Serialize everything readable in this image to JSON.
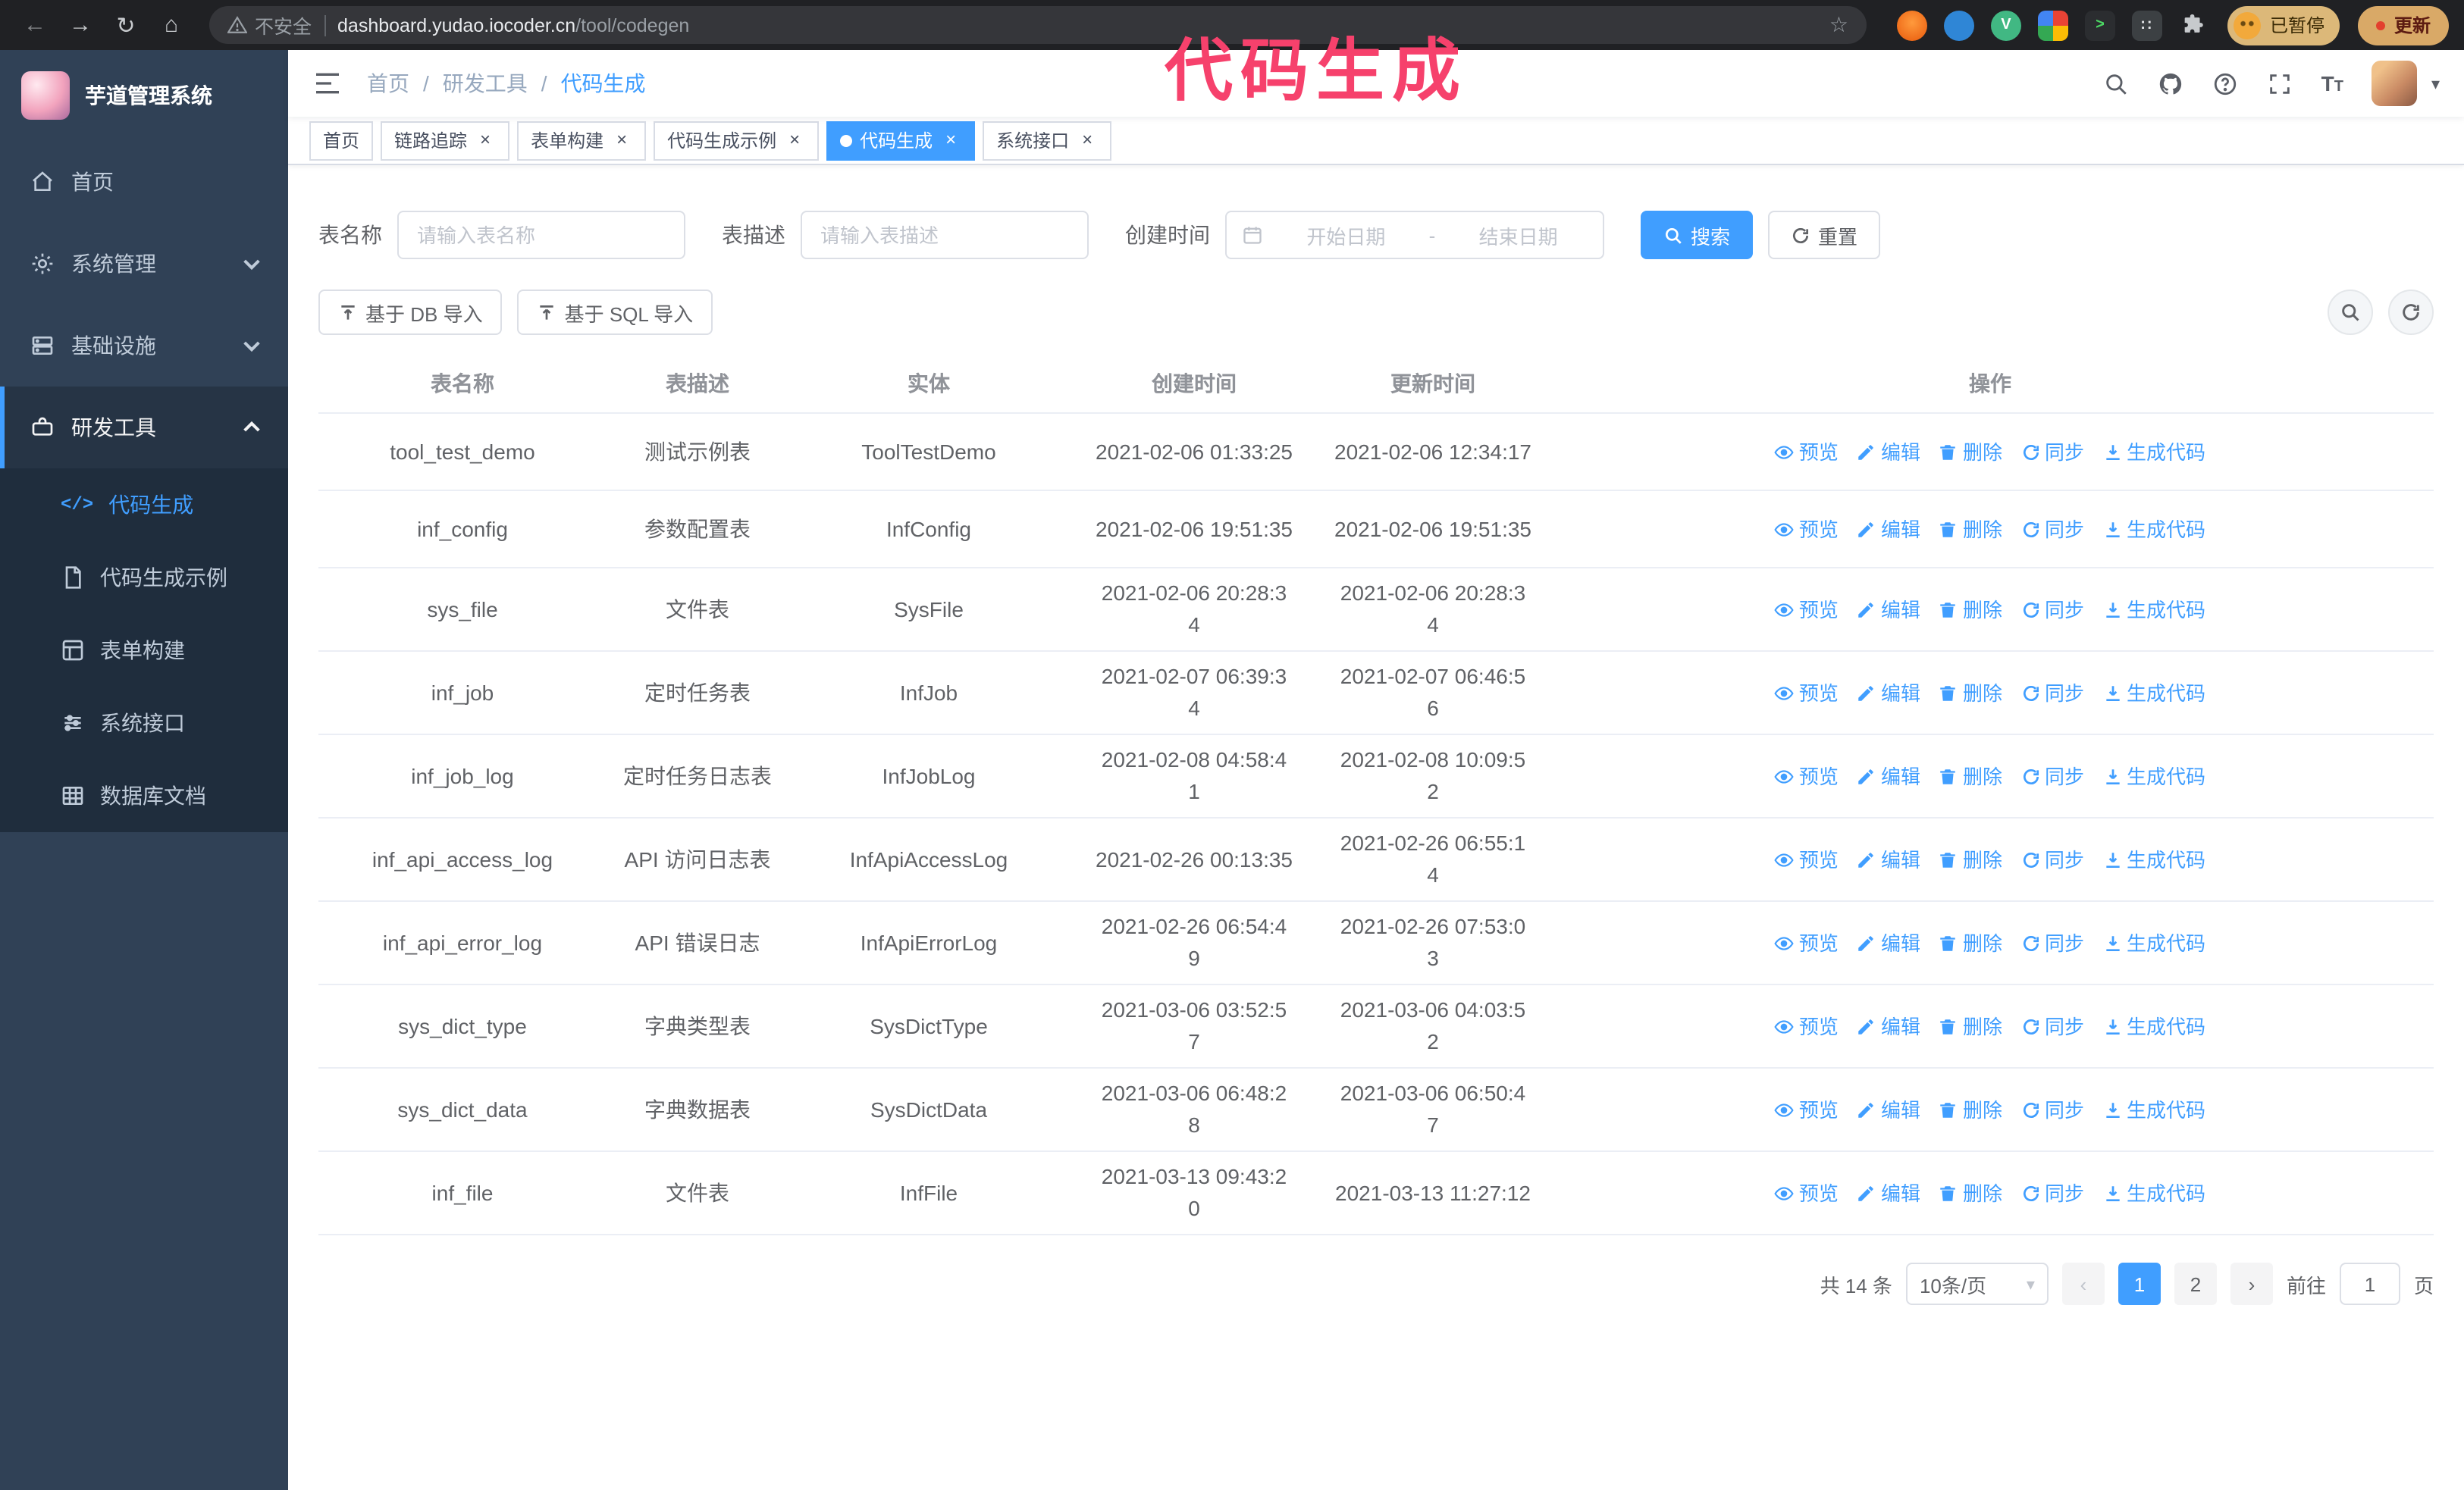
{
  "colors": {
    "primary": "#409eff",
    "annotation": "#f6416c",
    "sidebar_bg": "#304156",
    "submenu_bg": "#1f2d3d"
  },
  "icons": {
    "back": "←",
    "forward": "→",
    "reload": "↻",
    "home": "⌂",
    "star": "☆",
    "close": "×",
    "caret": "▾",
    "dot": "•",
    "separator": "/",
    "prev": "‹",
    "next": "›",
    "code": "</>",
    "terminal": ">",
    "vue": "V",
    "dark_ext": "::"
  },
  "browser": {
    "security_label": "不安全",
    "url_host": "dashboard.yudao.iocoder.cn",
    "url_path": "/tool/codegen",
    "paused_badge": "已暂停",
    "update_button": "更新"
  },
  "overlay": {
    "annotation": "代码生成"
  },
  "sidebar": {
    "app_title": "芋道管理系统",
    "items": [
      {
        "label": "首页"
      },
      {
        "label": "系统管理"
      },
      {
        "label": "基础设施"
      },
      {
        "label": "研发工具"
      }
    ],
    "submenu": [
      {
        "label": "代码生成",
        "active": true
      },
      {
        "label": "代码生成示例"
      },
      {
        "label": "表单构建"
      },
      {
        "label": "系统接口"
      },
      {
        "label": "数据库文档"
      }
    ]
  },
  "header": {
    "breadcrumb": [
      "首页",
      "研发工具",
      "代码生成"
    ]
  },
  "tabs": [
    {
      "label": "首页",
      "closable": false,
      "active": false
    },
    {
      "label": "链路追踪",
      "closable": true,
      "active": false
    },
    {
      "label": "表单构建",
      "closable": true,
      "active": false
    },
    {
      "label": "代码生成示例",
      "closable": true,
      "active": false
    },
    {
      "label": "代码生成",
      "closable": true,
      "active": true
    },
    {
      "label": "系统接口",
      "closable": true,
      "active": false
    }
  ],
  "filters": {
    "table_name_label": "表名称",
    "table_name_placeholder": "请输入表名称",
    "table_desc_label": "表描述",
    "table_desc_placeholder": "请输入表描述",
    "create_time_label": "创建时间",
    "date_start_placeholder": "开始日期",
    "date_separator": "-",
    "date_end_placeholder": "结束日期",
    "search_button": "搜索",
    "reset_button": "重置"
  },
  "toolbar": {
    "import_db": "基于 DB 导入",
    "import_sql": "基于 SQL 导入"
  },
  "table": {
    "columns": [
      "表名称",
      "表描述",
      "实体",
      "创建时间",
      "更新时间",
      "操作"
    ],
    "actions": [
      "预览",
      "编辑",
      "删除",
      "同步",
      "生成代码"
    ],
    "rows": [
      {
        "name": "tool_test_demo",
        "desc": "测试示例表",
        "entity": "ToolTestDemo",
        "created": "2021-02-06 01:33:25",
        "updated": "2021-02-06 12:34:17"
      },
      {
        "name": "inf_config",
        "desc": "参数配置表",
        "entity": "InfConfig",
        "created": "2021-02-06 19:51:35",
        "updated": "2021-02-06 19:51:35"
      },
      {
        "name": "sys_file",
        "desc": "文件表",
        "entity": "SysFile",
        "created": "2021-02-06 20:28:3\n4",
        "updated": "2021-02-06 20:28:3\n4"
      },
      {
        "name": "inf_job",
        "desc": "定时任务表",
        "entity": "InfJob",
        "created": "2021-02-07 06:39:3\n4",
        "updated": "2021-02-07 06:46:5\n6"
      },
      {
        "name": "inf_job_log",
        "desc": "定时任务日志表",
        "entity": "InfJobLog",
        "created": "2021-02-08 04:58:4\n1",
        "updated": "2021-02-08 10:09:5\n2"
      },
      {
        "name": "inf_api_access_log",
        "desc": "API 访问日志表",
        "entity": "InfApiAccessLog",
        "created": "2021-02-26 00:13:35",
        "updated": "2021-02-26 06:55:1\n4"
      },
      {
        "name": "inf_api_error_log",
        "desc": "API 错误日志",
        "entity": "InfApiErrorLog",
        "created": "2021-02-26 06:54:4\n9",
        "updated": "2021-02-26 07:53:0\n3"
      },
      {
        "name": "sys_dict_type",
        "desc": "字典类型表",
        "entity": "SysDictType",
        "created": "2021-03-06 03:52:5\n7",
        "updated": "2021-03-06 04:03:5\n2"
      },
      {
        "name": "sys_dict_data",
        "desc": "字典数据表",
        "entity": "SysDictData",
        "created": "2021-03-06 06:48:2\n8",
        "updated": "2021-03-06 06:50:4\n7"
      },
      {
        "name": "inf_file",
        "desc": "文件表",
        "entity": "InfFile",
        "created": "2021-03-13 09:43:2\n0",
        "updated": "2021-03-13 11:27:12"
      }
    ]
  },
  "pagination": {
    "total": "共 14 条",
    "page_size": "10条/页",
    "pages": [
      "1",
      "2"
    ],
    "goto_label": "前往",
    "goto_value": "1",
    "goto_suffix": "页"
  }
}
